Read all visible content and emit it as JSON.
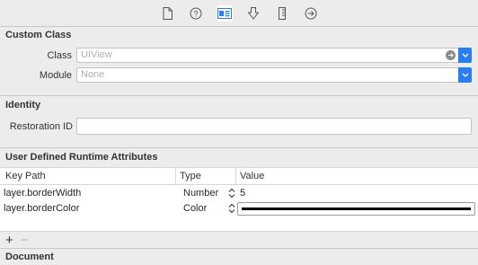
{
  "toolbar": {
    "icons": [
      "file-icon",
      "help-icon",
      "identity-icon",
      "attributes-icon",
      "size-icon",
      "connections-icon"
    ],
    "active_icon": "identity-icon"
  },
  "custom_class": {
    "title": "Custom Class",
    "class_label": "Class",
    "class_placeholder": "UIView",
    "module_label": "Module",
    "module_placeholder": "None"
  },
  "identity": {
    "title": "Identity",
    "restoration_label": "Restoration ID",
    "restoration_value": ""
  },
  "runtime_attributes": {
    "title": "User Defined Runtime Attributes",
    "columns": [
      "Key Path",
      "Type",
      "Value"
    ],
    "rows": [
      {
        "key_path": "layer.borderWidth",
        "type": "Number",
        "value": "5"
      },
      {
        "key_path": "layer.borderColor",
        "type": "Color",
        "value_color": "#000000"
      }
    ],
    "add_label": "+",
    "remove_label": "−"
  },
  "document": {
    "title": "Document"
  },
  "colors": {
    "accent": "#2a7ef0",
    "panel": "#ececec",
    "divider": "#c8c8c8"
  }
}
